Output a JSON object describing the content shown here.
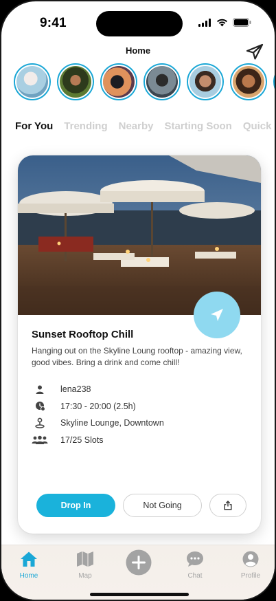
{
  "status_bar": {
    "time": "9:41"
  },
  "header": {
    "title": "Home"
  },
  "stories": [
    {
      "name": "story-1",
      "color": "#9cc4d8"
    },
    {
      "name": "story-2",
      "color": "#3f5a2c"
    },
    {
      "name": "story-3",
      "color": "#c97b4a"
    },
    {
      "name": "story-4",
      "color": "#4a5a6a"
    },
    {
      "name": "story-5",
      "color": "#8bb7cf"
    },
    {
      "name": "story-6",
      "color": "#c98f5a"
    },
    {
      "name": "story-7",
      "color": "#8a8a8a"
    }
  ],
  "tabs": [
    {
      "label": "For You",
      "active": true
    },
    {
      "label": "Trending",
      "active": false
    },
    {
      "label": "Nearby",
      "active": false
    },
    {
      "label": "Starting Soon",
      "active": false
    },
    {
      "label": "Quick",
      "active": false
    }
  ],
  "event": {
    "title": "Sunset Rooftop Chill",
    "description": "Hanging out on the Skyline Loung rooftop - amazing view, good vibes. Bring a drink and come chill!",
    "host": "lena238",
    "time": "17:30 - 20:00 (2.5h)",
    "location": "Skyline Lounge, Downtown",
    "slots": "17/25 Slots"
  },
  "actions": {
    "primary": "Drop In",
    "secondary": "Not Going"
  },
  "tabbar": [
    {
      "label": "Home",
      "icon": "home-icon",
      "active": true
    },
    {
      "label": "Map",
      "icon": "map-icon",
      "active": false
    },
    {
      "label": "",
      "icon": "plus-icon",
      "active": false
    },
    {
      "label": "Chat",
      "icon": "chat-icon",
      "active": false
    },
    {
      "label": "Profile",
      "icon": "profile-icon",
      "active": false
    }
  ],
  "colors": {
    "accent": "#1ab2db",
    "fab": "#8fd9f0"
  }
}
